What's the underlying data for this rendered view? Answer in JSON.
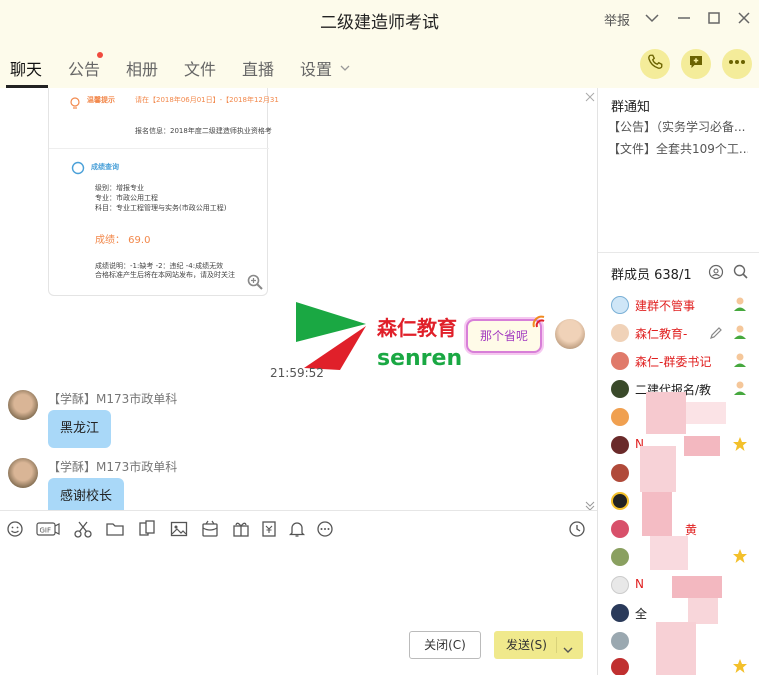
{
  "window": {
    "title": "二级建造师考试",
    "report_label": "举报"
  },
  "tabs": [
    {
      "label": "聊天",
      "active": true
    },
    {
      "label": "公告",
      "badge": true
    },
    {
      "label": "相册"
    },
    {
      "label": "文件"
    },
    {
      "label": "直播"
    },
    {
      "label": "设置"
    }
  ],
  "chat": {
    "card": {
      "reminder_title": "温馨提示",
      "reminder_text": "请在【2018年06月01日】-【2018年12月31",
      "info_line": "报名信息：2018年度二级建造师执业资格考",
      "query_title": "成绩查询",
      "level_line": "级别：增报专业",
      "major_line": "专业：市政公用工程",
      "subject_line": "科目：专业工程管理与实务(市政公用工程)",
      "score_line": "成绩： 69.0",
      "note_line1": "成绩说明：-1:缺考  -2：违纪  -4:成绩无效",
      "note_line2": "合格标准产生后将在本网站发布，请及时关注"
    },
    "logo": {
      "cn": "森仁教育",
      "en": "senren"
    },
    "nick_badge": "那个省呢",
    "timestamp": "21:59:52",
    "messages": [
      {
        "sender": "【学酥】M173市政单科",
        "text": "黑龙江"
      },
      {
        "sender": "【学酥】M173市政单科",
        "text": "感谢校长"
      }
    ]
  },
  "compose": {
    "close_label": "关闭(C)",
    "send_label": "发送(S)"
  },
  "right": {
    "notice_title": "群通知",
    "notice_lines": [
      "【公告】（实务学习必备...",
      "【文件】全套共109个工..."
    ],
    "members_title": "群成员 638/1",
    "members": [
      {
        "name": "建群不管事",
        "color": "#e02020"
      },
      {
        "name": "森仁教育-",
        "color": "#e02020"
      },
      {
        "name": "森仁-群委书记",
        "color": "#e02020"
      },
      {
        "name": "二建代报名/教",
        "color": "#222222"
      },
      {
        "name": "",
        "color": "#e02020"
      },
      {
        "name": "N",
        "color": "#e02020"
      },
      {
        "name": "",
        "color": "#222222"
      },
      {
        "name": "",
        "color": "#222222"
      },
      {
        "name": "黄",
        "color": "#e02020"
      },
      {
        "name": "",
        "color": "#e02020"
      },
      {
        "name": "N",
        "color": "#e02020"
      },
      {
        "name": "全",
        "color": "#222222"
      }
    ]
  },
  "colors": {
    "titlebar_bg": "#fdfbeb",
    "bubble": "#a9d8f8",
    "send_button": "#f0e98c",
    "badge_dot": "#f04a3e",
    "member_red": "#e02020"
  }
}
